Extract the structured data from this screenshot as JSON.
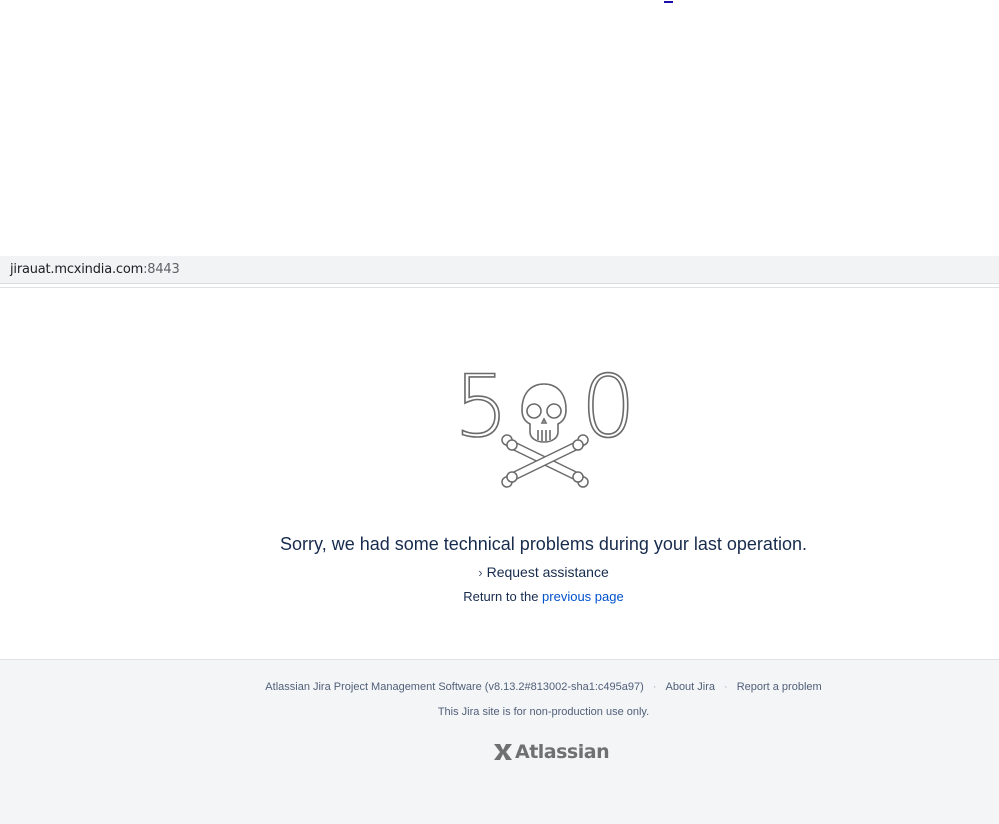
{
  "browser": {
    "url_host": "jirauat.mcxindia.com",
    "url_port": ":8443"
  },
  "error": {
    "code_left": "5",
    "code_right": "0",
    "message": "Sorry, we had some technical problems during your last operation.",
    "assist_label": "Request assistance",
    "return_prefix": "Return to the",
    "return_link": "previous page"
  },
  "footer": {
    "software_label": "Atlassian Jira Project Management Software (v8.13.2#813002-sha1:c495a97)",
    "about_label": "About Jira",
    "report_label": "Report a problem",
    "note": "This Jira site is for non-production use only.",
    "logo_text": "Atlassian"
  },
  "colors": {
    "link": "#0052cc",
    "footer_bg": "#f4f5f7",
    "art_stroke": "#6b6b6b"
  }
}
